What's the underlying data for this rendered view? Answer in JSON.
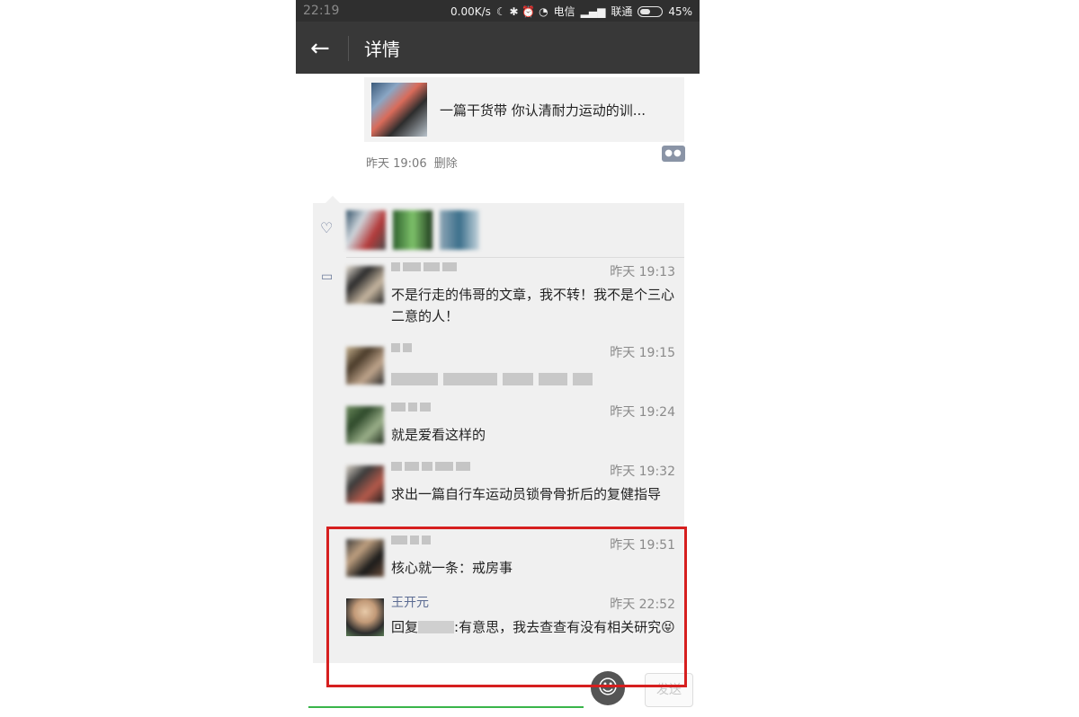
{
  "status_bar": {
    "time": "22:19",
    "right_text": "0.00K/s",
    "carrier1": "电信",
    "carrier2": "联通",
    "battery": "45%"
  },
  "app_bar": {
    "title": "详情",
    "back_icon": "arrow-left-icon"
  },
  "post": {
    "article_title": "一篇干货带 你认清耐力运动的训...",
    "time": "昨天 19:06",
    "delete_label": "删除",
    "comment_button_icon": "comment-more-icon"
  },
  "comments": [
    {
      "time": "昨天 19:13",
      "text": "不是行走的伟哥的文章，我不转！我不是个三心二意的人！"
    },
    {
      "time": "昨天 19:15",
      "text": ""
    },
    {
      "time": "昨天 19:24",
      "text": "就是爱看这样的"
    },
    {
      "time": "昨天 19:32",
      "text": "求出一篇自行车运动员锁骨骨折后的复健指导"
    },
    {
      "time": "昨天 19:51",
      "text": "核心就一条：戒房事"
    },
    {
      "name": "王开元",
      "time": "昨天 22:52",
      "reply_prefix": "回复",
      "reply_suffix": ":有意思，我去查查有没有相关研究😝"
    }
  ],
  "input_bar": {
    "emoji_icon": "emoji-icon",
    "send_label": "发送"
  },
  "colors": {
    "highlight": "#d61f1f",
    "accent_green": "#39b54a",
    "name_blue": "#5b6b92"
  }
}
